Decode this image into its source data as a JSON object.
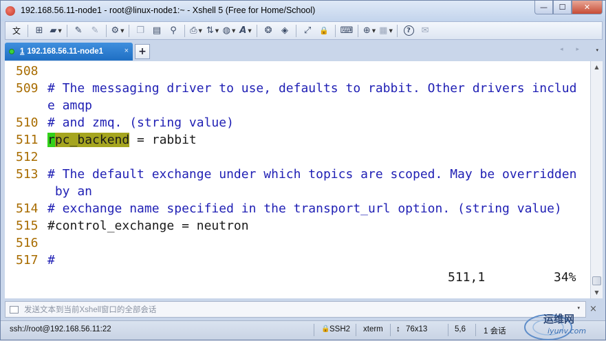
{
  "window": {
    "title": "192.168.56.11-node1 - root@linux-node1:~ - Xshell 5 (Free for Home/School)",
    "controls": {
      "minimize": "—",
      "maximize": "☐",
      "close": "✕"
    }
  },
  "toolbar": {
    "items": [
      {
        "name": "text-menu",
        "label": "文"
      },
      {
        "name": "new-session",
        "icon": "new-session-icon",
        "glyph": "⊞"
      },
      {
        "name": "open",
        "icon": "folder-icon",
        "glyph": "▰"
      },
      {
        "name": "highlight",
        "icon": "pen-icon",
        "glyph": "✎"
      },
      {
        "name": "settings",
        "icon": "gear-icon",
        "glyph": "⚙"
      },
      {
        "name": "copy",
        "icon": "copy-icon",
        "glyph": "❐"
      },
      {
        "name": "paste",
        "icon": "paste-icon",
        "glyph": "▤"
      },
      {
        "name": "find",
        "icon": "search-icon",
        "glyph": "⚲"
      },
      {
        "name": "print",
        "icon": "printer-icon",
        "glyph": "⎙"
      },
      {
        "name": "transfer",
        "icon": "transfer-icon",
        "glyph": "⇅"
      },
      {
        "name": "globe",
        "icon": "globe-icon",
        "glyph": "◍"
      },
      {
        "name": "font",
        "icon": "font-icon",
        "glyph": "A"
      },
      {
        "name": "script",
        "icon": "script-icon",
        "glyph": "❂"
      },
      {
        "name": "record",
        "icon": "record-icon",
        "glyph": "◈"
      },
      {
        "name": "fullscreen",
        "icon": "fullscreen-icon",
        "glyph": "⤢"
      },
      {
        "name": "lock",
        "icon": "lock-icon",
        "glyph": "🔒"
      },
      {
        "name": "keyboard",
        "icon": "keyboard-icon",
        "glyph": "⌨"
      },
      {
        "name": "add",
        "icon": "plus-box-icon",
        "glyph": "⊕"
      },
      {
        "name": "layout",
        "icon": "layout-icon",
        "glyph": "▦"
      },
      {
        "name": "help",
        "icon": "help-icon",
        "glyph": "?"
      },
      {
        "name": "chat",
        "icon": "chat-icon",
        "glyph": "✉"
      }
    ]
  },
  "tabs": {
    "active": {
      "number": "1",
      "label": "192.168.56.11-node1",
      "close": "×"
    },
    "add": "+",
    "nav": "◂ ▸",
    "menu": "▾"
  },
  "terminal": {
    "lines": [
      {
        "num": "508",
        "segments": []
      },
      {
        "num": "509",
        "segments": [
          {
            "text": "# The messaging driver to use, defaults to rabbit. Other drivers includ",
            "style": "comment"
          }
        ]
      },
      {
        "num": "",
        "segments": [
          {
            "text": "e amqp",
            "style": "comment"
          }
        ]
      },
      {
        "num": "510",
        "segments": [
          {
            "text": "# and zmq. (string value)",
            "style": "comment"
          }
        ]
      },
      {
        "num": "511",
        "segments": [
          {
            "text": "r",
            "style": "cursor"
          },
          {
            "text": "pc_backend",
            "style": "hl"
          },
          {
            "text": " = rabbit",
            "style": "plain"
          }
        ]
      },
      {
        "num": "512",
        "segments": []
      },
      {
        "num": "513",
        "segments": [
          {
            "text": "# The default exchange under which topics are scoped. May be overridden",
            "style": "comment"
          }
        ]
      },
      {
        "num": "",
        "segments": [
          {
            "text": " by an",
            "style": "comment"
          }
        ]
      },
      {
        "num": "514",
        "segments": [
          {
            "text": "# exchange name specified in the transport_url option. (string value)",
            "style": "comment"
          }
        ]
      },
      {
        "num": "515",
        "segments": [
          {
            "text": "#control_exchange = neutron",
            "style": "plain"
          }
        ]
      },
      {
        "num": "516",
        "segments": []
      },
      {
        "num": "517",
        "segments": [
          {
            "text": "#",
            "style": "comment"
          }
        ]
      }
    ],
    "position": "511,1",
    "percent": "34%"
  },
  "compose": {
    "placeholder": "发送文本到当前Xshell窗口的全部会话",
    "menu": "▾",
    "close": "×"
  },
  "statusbar": {
    "connection": "ssh://root@192.168.56.11:22",
    "protocol": "SSH2",
    "terminal_type": "xterm",
    "size": "76x13",
    "cursor": "5,6",
    "sessions": "1 会话"
  },
  "watermark": {
    "text": "运维网",
    "sub": "iyunv.com"
  }
}
